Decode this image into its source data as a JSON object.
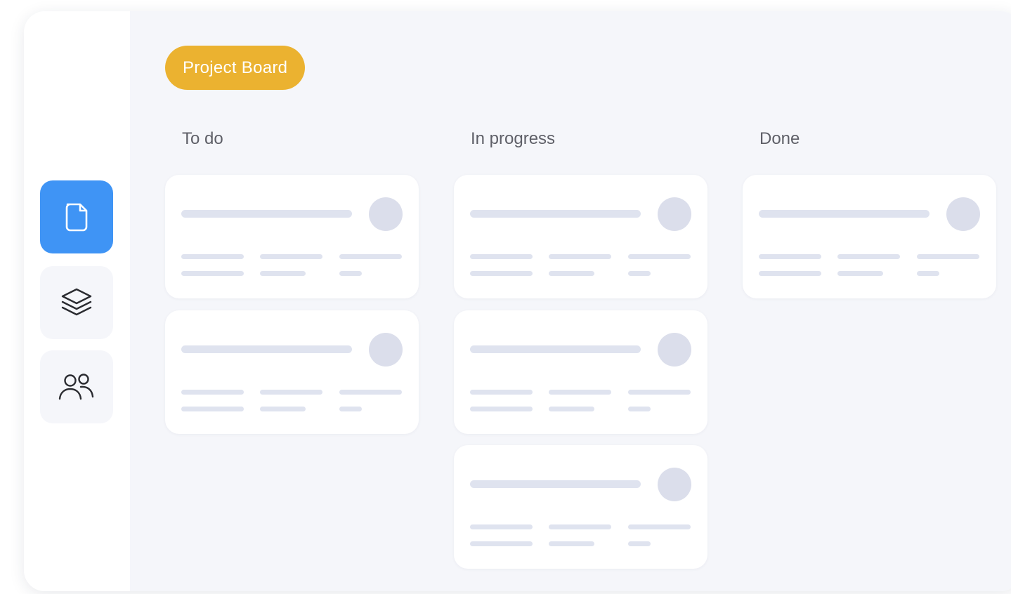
{
  "board": {
    "title": "Project Board",
    "accent_color": "#ebb230",
    "active_nav_color": "#3f94f5"
  },
  "sidebar": {
    "items": [
      {
        "icon": "document-icon",
        "active": true
      },
      {
        "icon": "layers-icon",
        "active": false
      },
      {
        "icon": "users-icon",
        "active": false
      }
    ]
  },
  "columns": [
    {
      "title": "To do",
      "card_count": 2
    },
    {
      "title": "In progress",
      "card_count": 3
    },
    {
      "title": "Done",
      "card_count": 1
    }
  ]
}
